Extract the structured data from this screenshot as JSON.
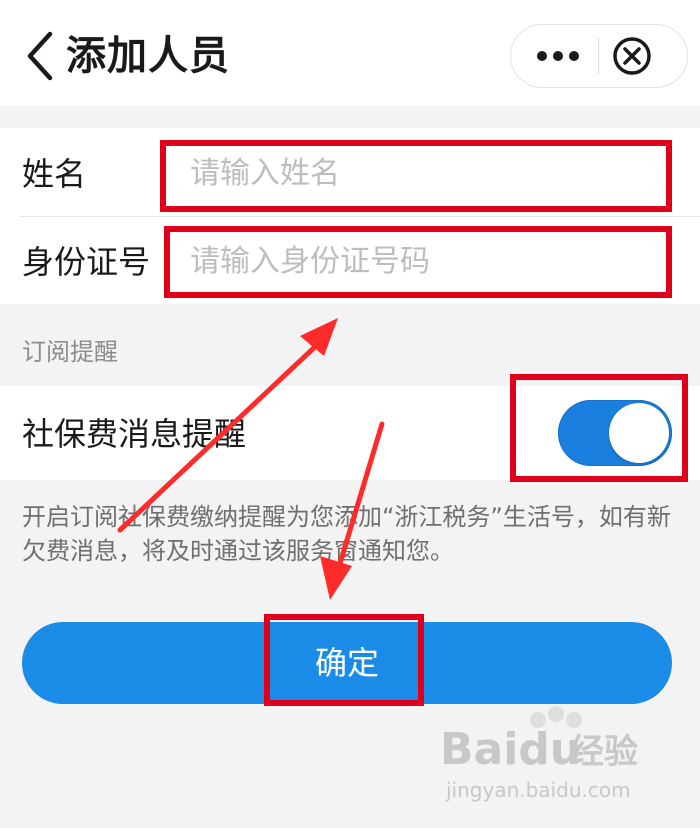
{
  "navbar": {
    "title": "添加人员",
    "back_icon": "chevron-left-icon",
    "more_icon": "more-dots-icon",
    "close_icon": "close-circle-icon"
  },
  "form": {
    "name_label": "姓名",
    "name_placeholder": "请输入姓名",
    "name_value": "",
    "id_label": "身份证号",
    "id_placeholder": "请输入身份证号码",
    "id_value": ""
  },
  "subscription": {
    "section_title": "订阅提醒",
    "switch_label": "社保费消息提醒",
    "switch_on": true,
    "hint": "开启订阅社保费缴纳提醒为您添加“浙江税务”生活号，如有新欠费消息，将及时通过该服务窗通知您。"
  },
  "confirm_label": "确定",
  "watermark": {
    "brand": "Baidu",
    "sub": "经验",
    "url": "jingyan.baidu.com"
  },
  "colors": {
    "primary": "#1b8be8",
    "toggle_on": "#1b7fe0",
    "annotation_red": "#e0001a",
    "background": "#f3f3f3"
  }
}
